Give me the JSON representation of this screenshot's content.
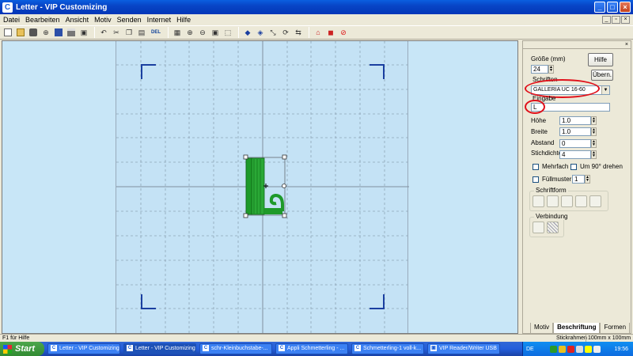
{
  "window": {
    "title": "Letter - VIP Customizing",
    "app_icon": "C"
  },
  "menu": [
    {
      "label": "Datei",
      "accel": "D"
    },
    {
      "label": "Bearbeiten",
      "accel": "B"
    },
    {
      "label": "Ansicht",
      "accel": "A"
    },
    {
      "label": "Motiv",
      "accel": "M"
    },
    {
      "label": "Senden",
      "accel": "S"
    },
    {
      "label": "Internet",
      "accel": "I"
    },
    {
      "label": "Hilfe",
      "accel": "H"
    }
  ],
  "toolbar": {
    "del_label": "DEL"
  },
  "panel": {
    "size_label": "Größe (mm)",
    "size_value": "24",
    "help_button": "Hilfe",
    "apply_button": "Übern.",
    "font_label": "Schriften",
    "font_value": "GALLERIA UC 16-60",
    "input_label": "Eingabe",
    "input_value": "L",
    "height_label": "Höhe",
    "height_value": "1.0",
    "width_label": "Breite",
    "width_value": "1.0",
    "spacing_label": "Abstand",
    "spacing_value": "0",
    "density_label": "Stichdichte",
    "density_value": "4",
    "multiple_label": "Mehrfach",
    "rotate_label": "Um 90° drehen",
    "fill_label": "Füllmuster",
    "fill_value": "1",
    "shape_group": "Schriftform",
    "connection_group": "Verbindung"
  },
  "tabs": [
    {
      "label": "Motiv"
    },
    {
      "label": "Beschriftung",
      "active": true
    },
    {
      "label": "Formen"
    }
  ],
  "status": {
    "help": "F1 für Hilfe",
    "frame_label": "Stickrahmen",
    "frame_size": "100mm x 100mm"
  },
  "taskbar": {
    "start": "Start",
    "tasks": [
      {
        "label": "Letter - VIP Customizing",
        "icon": "C"
      },
      {
        "label": "Letter - VIP Customizing",
        "icon": "C",
        "active": true
      },
      {
        "label": "schr-Kleinbuchstabe-...",
        "icon": "C"
      },
      {
        "label": "Appli Schmetterling - ...",
        "icon": "C"
      },
      {
        "label": "Schmetterling-1 voll-k...",
        "icon": "C"
      },
      {
        "label": "VIP Reader/Writer USB",
        "icon": "▣"
      }
    ],
    "lang": "DE",
    "clock": "19:56"
  },
  "colors": {
    "stitch": "#1e9a2a",
    "stitch_dark": "#0d6a17",
    "hoop_marks": "#1a3fa0",
    "highlight": "#e0101a"
  }
}
